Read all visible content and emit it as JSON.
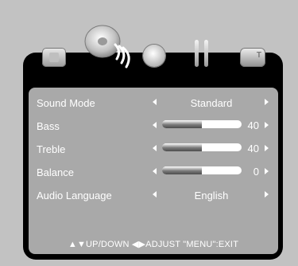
{
  "tabs": [
    {
      "icon": "picture-icon"
    },
    {
      "icon": "sound-icon",
      "selected": true
    },
    {
      "icon": "timer-icon"
    },
    {
      "icon": "setup-icon"
    },
    {
      "icon": "tv-icon"
    }
  ],
  "menu": {
    "rows": [
      {
        "label": "Sound Mode",
        "type": "select",
        "value": "Standard"
      },
      {
        "label": "Bass",
        "type": "slider",
        "value": "40",
        "level": 0.5
      },
      {
        "label": "Treble",
        "type": "slider",
        "value": "40",
        "level": 0.5
      },
      {
        "label": "Balance",
        "type": "slider",
        "value": "0",
        "level": 0.5
      },
      {
        "label": "Audio Language",
        "type": "select",
        "value": "English"
      }
    ]
  },
  "footer": {
    "text": "▲▼UP/DOWN  ◀▶ADJUST  \"MENU\":EXIT"
  },
  "colors": {
    "background": "#c2c2c2",
    "panel": "#000000",
    "inner_panel": "#a9a9a9",
    "text": "#ffffff"
  }
}
